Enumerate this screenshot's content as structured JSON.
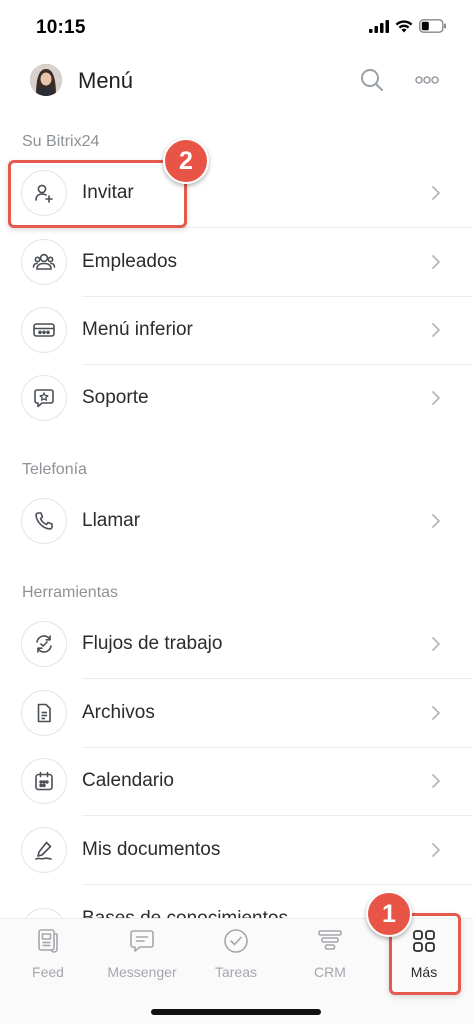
{
  "status": {
    "time": "10:15"
  },
  "header": {
    "title": "Menú"
  },
  "sections": {
    "bitrix": "Su Bitrix24",
    "telefonia": "Telefonía",
    "herramientas": "Herramientas"
  },
  "items": {
    "invitar": "Invitar",
    "empleados": "Empleados",
    "menu_inferior": "Menú inferior",
    "soporte": "Soporte",
    "llamar": "Llamar",
    "flujos": "Flujos de trabajo",
    "archivos": "Archivos",
    "calendario": "Calendario",
    "mis_documentos": "Mis documentos",
    "bases": "Bases de conocimientos"
  },
  "tabs": {
    "feed": "Feed",
    "messenger": "Messenger",
    "tareas": "Tareas",
    "crm": "CRM",
    "mas": "Más"
  },
  "callouts": {
    "one": "1",
    "two": "2"
  },
  "colors": {
    "callout": "#e85546",
    "active_tab": "#2b2b2b",
    "inactive_tab": "#a4a7ac"
  }
}
